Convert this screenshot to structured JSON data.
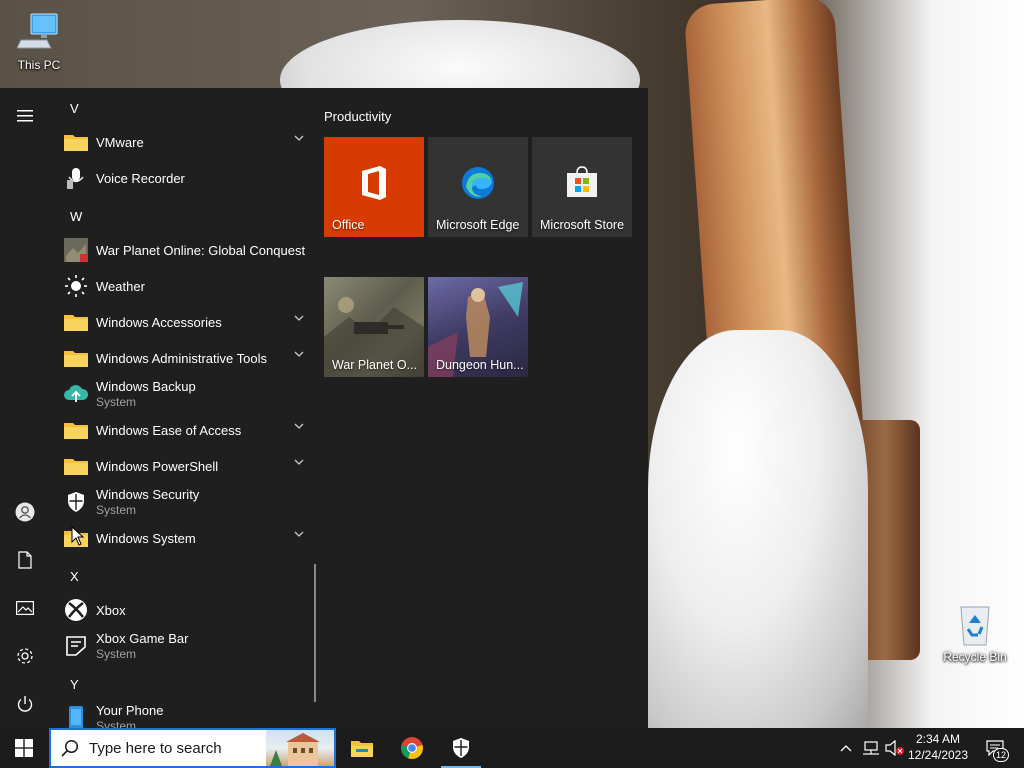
{
  "desktop": {
    "icons": [
      {
        "label": "This PC"
      },
      {
        "label": "Recycle Bin"
      }
    ]
  },
  "start_menu": {
    "rail": {
      "menu_icon": "hamburger-icon",
      "items": [
        "user-icon",
        "document-icon",
        "pictures-icon",
        "settings-icon",
        "power-icon"
      ]
    },
    "letters": [
      "V",
      "W",
      "X",
      "Y"
    ],
    "apps": [
      {
        "name": "VMware",
        "sub": "",
        "icon": "folder-icon",
        "expandable": true
      },
      {
        "name": "Voice Recorder",
        "sub": "",
        "icon": "microphone-icon",
        "expandable": false
      },
      {
        "name": "War Planet Online: Global Conquest",
        "sub": "",
        "icon": "game-icon",
        "expandable": false
      },
      {
        "name": "Weather",
        "sub": "",
        "icon": "sun-icon",
        "expandable": false
      },
      {
        "name": "Windows Accessories",
        "sub": "",
        "icon": "folder-icon",
        "expandable": true
      },
      {
        "name": "Windows Administrative Tools",
        "sub": "",
        "icon": "folder-icon",
        "expandable": true
      },
      {
        "name": "Windows Backup",
        "sub": "System",
        "icon": "cloud-upload-icon",
        "expandable": false
      },
      {
        "name": "Windows Ease of Access",
        "sub": "",
        "icon": "folder-icon",
        "expandable": true
      },
      {
        "name": "Windows PowerShell",
        "sub": "",
        "icon": "folder-icon",
        "expandable": true
      },
      {
        "name": "Windows Security",
        "sub": "System",
        "icon": "shield-icon",
        "expandable": false
      },
      {
        "name": "Windows System",
        "sub": "",
        "icon": "folder-icon",
        "expandable": true
      },
      {
        "name": "Xbox",
        "sub": "",
        "icon": "xbox-icon",
        "expandable": false
      },
      {
        "name": "Xbox Game Bar",
        "sub": "System",
        "icon": "game-bar-icon",
        "expandable": false
      },
      {
        "name": "Your Phone",
        "sub": "System",
        "icon": "phone-icon",
        "expandable": false
      }
    ],
    "tiles": {
      "group_title": "Productivity",
      "items": [
        {
          "label": "Office",
          "icon": "office-icon",
          "color": "#d83b01"
        },
        {
          "label": "Microsoft Edge",
          "icon": "edge-icon",
          "color": "#333333"
        },
        {
          "label": "Microsoft Store",
          "icon": "store-icon",
          "color": "#333333"
        },
        {
          "label": "War Planet O...",
          "icon": "war-planet-art",
          "color": "#6c6a5c"
        },
        {
          "label": "Dungeon Hun...",
          "icon": "dungeon-hunter-art",
          "color": "#4e4a72"
        }
      ]
    }
  },
  "taskbar": {
    "search_placeholder": "Type here to search",
    "pinned": [
      "file-explorer-icon",
      "chrome-icon",
      "windows-security-icon"
    ],
    "tray": {
      "time": "2:34 AM",
      "date": "12/24/2023",
      "notification_count": "12"
    }
  },
  "colors": {
    "accent": "#1a73d6",
    "office": "#d83b01",
    "folder": "#f3c13a",
    "start_bg": "#1f1f1f",
    "taskbar_bg": "#1c1c1c"
  }
}
